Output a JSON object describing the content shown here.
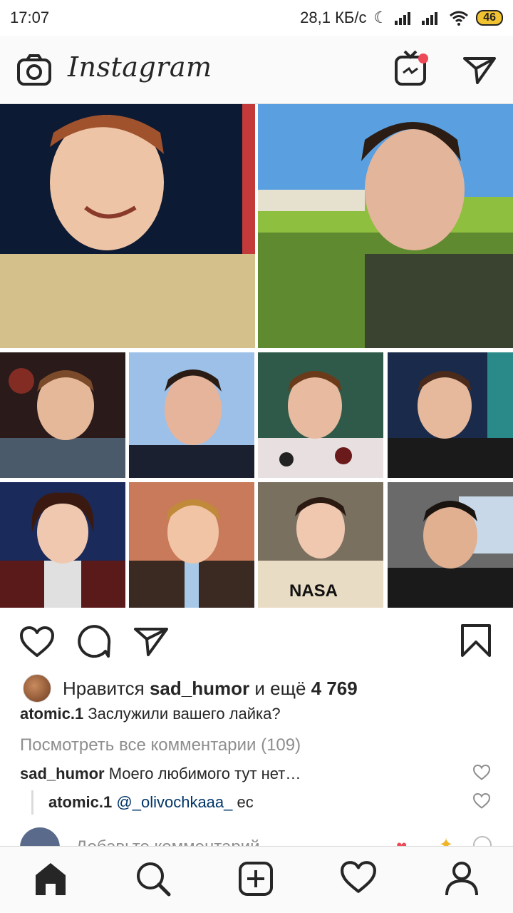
{
  "status_bar": {
    "time": "17:07",
    "network_speed": "28,1 КБ/с",
    "battery": "46"
  },
  "header": {
    "app_name": "Instagram",
    "icons": [
      "camera-icon",
      "igtv-icon",
      "direct-message-icon"
    ]
  },
  "post": {
    "photo_grid": {
      "rows": 3,
      "layout": "2 large photos on top, 8 small photos below (2 rows of 4)"
    },
    "action_icons": [
      "like-icon",
      "comment-icon",
      "share-icon",
      "save-icon"
    ],
    "likes": {
      "prefix": "Нравится",
      "user": "sad_humor",
      "middle": "и ещё",
      "count": "4 769"
    },
    "caption": {
      "user": "atomic.1",
      "text": "Заслужили вашего лайка?"
    },
    "view_all_comments": "Посмотреть все комментарии (109)",
    "comments": [
      {
        "user": "sad_humor",
        "text": "Моего любимого тут нет…"
      },
      {
        "user": "atomic.1",
        "mention": "@_olivochkaaa_",
        "text": "ес"
      }
    ],
    "add_comment_placeholder": "Добавьте комментарий..."
  },
  "bottom_nav": [
    "home-icon",
    "search-icon",
    "new-post-icon",
    "activity-icon",
    "profile-icon"
  ],
  "colors": {
    "text": "#262626",
    "muted": "#8e8e8e",
    "mention": "#003569",
    "notification": "#ed4956"
  }
}
